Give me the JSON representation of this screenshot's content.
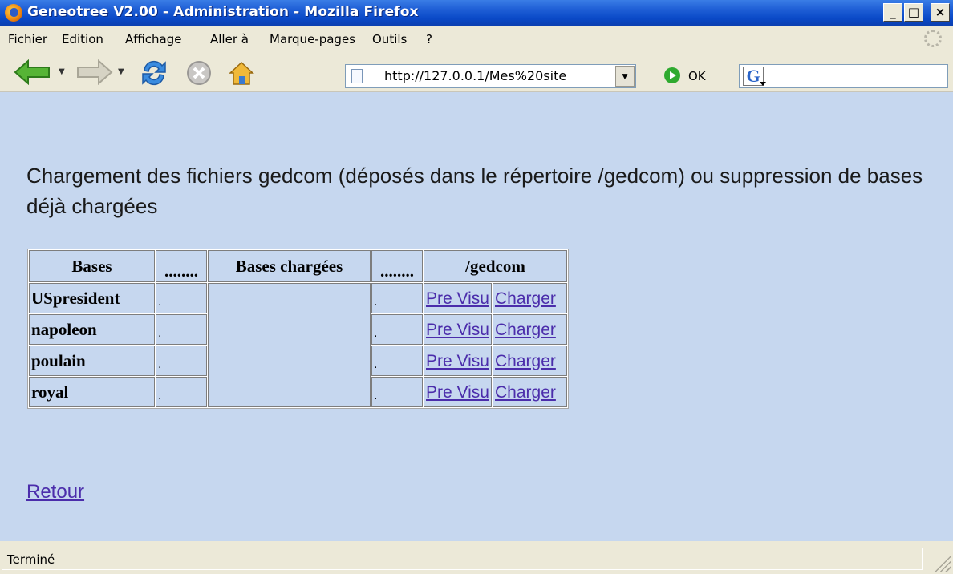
{
  "window": {
    "title": "Geneotree V2.00 - Administration - Mozilla Firefox",
    "minimize": "_",
    "maximize": "□",
    "close": "×"
  },
  "menu": {
    "items": [
      "Fichier",
      "Edition",
      "Affichage",
      "Aller à",
      "Marque-pages",
      "Outils",
      "?"
    ]
  },
  "toolbar": {
    "url": "http://127.0.0.1/Mes%20site",
    "go_label": "OK"
  },
  "page": {
    "heading": "Chargement des fichiers gedcom (déposés dans le répertoire /gedcom) ou suppression de bases déjà chargées",
    "table": {
      "headers": [
        "Bases",
        "........",
        "Bases chargées",
        "........",
        "/gedcom"
      ],
      "rows": [
        {
          "base": "USpresident",
          "dot1": ".",
          "dot2": ".",
          "preview": "Pre Visu",
          "load": "Charger"
        },
        {
          "base": "napoleon",
          "dot1": ".",
          "dot2": ".",
          "preview": "Pre Visu",
          "load": "Charger"
        },
        {
          "base": "poulain",
          "dot1": ".",
          "dot2": ".",
          "preview": "Pre Visu",
          "load": "Charger"
        },
        {
          "base": "royal",
          "dot1": ".",
          "dot2": ".",
          "preview": "Pre Visu",
          "load": "Charger"
        }
      ]
    },
    "back_link": "Retour"
  },
  "status": {
    "text": "Terminé"
  },
  "icons": {
    "back": "back-arrow-icon",
    "forward": "forward-arrow-icon",
    "reload": "reload-icon",
    "stop": "stop-icon",
    "home": "home-icon",
    "page": "page-icon",
    "go": "go-icon",
    "search_engine": "google-icon"
  },
  "colors": {
    "titlebar": "#0a49c7",
    "chrome": "#ece9d8",
    "page_background": "#c6d7ef",
    "link": "#4b2dab"
  }
}
